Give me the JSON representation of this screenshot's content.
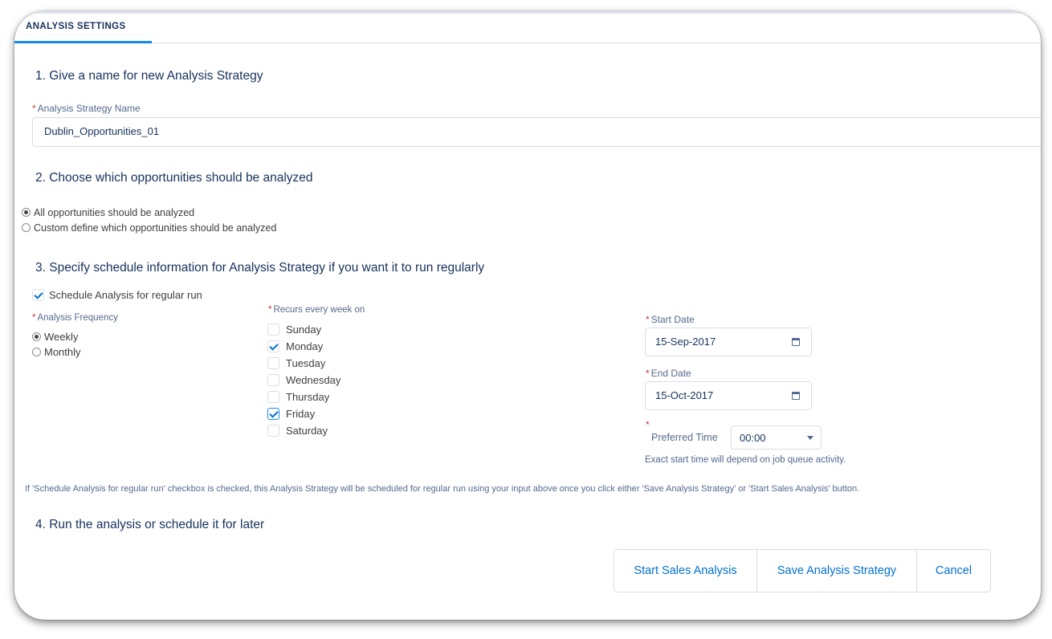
{
  "tab": {
    "label": "ANALYSIS SETTINGS"
  },
  "section1": {
    "heading": "1. Give a name for new Analysis Strategy",
    "name_label": "Analysis Strategy Name",
    "name_value": "Dublin_Opportunities_01"
  },
  "section2": {
    "heading": "2. Choose which opportunities should be analyzed",
    "options": [
      {
        "label": "All opportunities should be analyzed",
        "selected": true
      },
      {
        "label": "Custom define which opportunities should be analyzed",
        "selected": false
      }
    ]
  },
  "section3": {
    "heading": "3. Specify schedule information for Analysis Strategy if you want it to run regularly",
    "schedule_checkbox_label": "Schedule Analysis for regular run",
    "schedule_checked": true,
    "frequency_label": "Analysis Frequency",
    "frequency_options": [
      {
        "label": "Weekly",
        "selected": true
      },
      {
        "label": "Monthly",
        "selected": false
      }
    ],
    "recurs_label": "Recurs every week on",
    "days": [
      {
        "label": "Sunday",
        "checked": false
      },
      {
        "label": "Monday",
        "checked": true
      },
      {
        "label": "Tuesday",
        "checked": false
      },
      {
        "label": "Wednesday",
        "checked": false
      },
      {
        "label": "Thursday",
        "checked": false
      },
      {
        "label": "Friday",
        "checked": true
      },
      {
        "label": "Saturday",
        "checked": false
      }
    ],
    "start_date_label": "Start Date",
    "start_date_value": "15-Sep-2017",
    "end_date_label": "End Date",
    "end_date_value": "15-Oct-2017",
    "preferred_time_label": "Preferred Time",
    "preferred_time_value": "00:00",
    "time_note": "Exact start time will depend on job queue activity.",
    "info_note": "If 'Schedule Analysis for regular run' checkbox is checked, this Analysis Strategy will be scheduled for regular run using your input above once you click either 'Save Analysis Strategy' or 'Start Sales Analysis' button."
  },
  "section4": {
    "heading": "4. Run the analysis or schedule it for later",
    "buttons": {
      "start": "Start Sales Analysis",
      "save": "Save Analysis Strategy",
      "cancel": "Cancel"
    }
  },
  "required_marker": "*",
  "colors": {
    "accent": "#1589ee",
    "link": "#0070d2",
    "heading": "#16325c",
    "required": "#c23934"
  }
}
